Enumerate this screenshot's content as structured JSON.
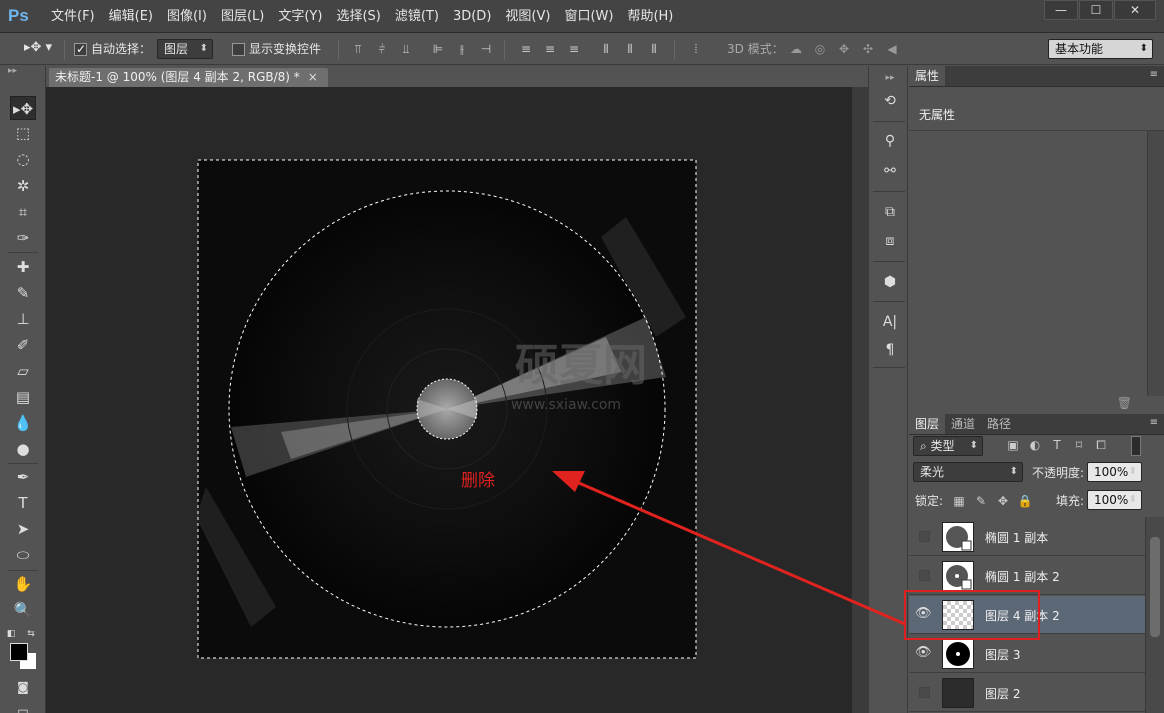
{
  "app": {
    "logo": "Ps",
    "menu": [
      "文件(F)",
      "编辑(E)",
      "图像(I)",
      "图层(L)",
      "文字(Y)",
      "选择(S)",
      "滤镜(T)",
      "3D(D)",
      "视图(V)",
      "窗口(W)",
      "帮助(H)"
    ],
    "window_controls": [
      "—",
      "☐",
      "✕"
    ]
  },
  "options": {
    "auto_select_label": "自动选择：",
    "auto_select_checked": true,
    "auto_select_target": "图层",
    "show_transform_label": "显示变换控件",
    "mode3d_label": "3D 模式：",
    "workspace": "基本功能"
  },
  "document": {
    "tab_title": "未标题-1 @ 100% (图层 4 副本 2, RGB/8) *",
    "tab_close": "×",
    "watermark_main": "硕夏网",
    "watermark_sub": "www.sxiaw.com",
    "annotation": "删除"
  },
  "properties": {
    "tab": "属性",
    "content": "无属性"
  },
  "layers": {
    "tabs": [
      "图层",
      "通道",
      "路径"
    ],
    "filter_kind": "类型",
    "blend_mode": "柔光",
    "opacity_label": "不透明度:",
    "opacity_value": "100%",
    "lock_label": "锁定:",
    "fill_label": "填充:",
    "fill_value": "100%",
    "rows": [
      {
        "name": "椭圆 1 副本",
        "visible": false
      },
      {
        "name": "椭圆 1 副本 2",
        "visible": false
      },
      {
        "name": "图层 4 副本 2",
        "visible": true,
        "selected": true
      },
      {
        "name": "图层 3",
        "visible": true
      },
      {
        "name": "图层 2",
        "visible": false
      }
    ]
  },
  "colors": {
    "annotation_red": "#e0231f",
    "ps_blue": "#6fb6ef",
    "selected_layer": "#5d6876"
  }
}
